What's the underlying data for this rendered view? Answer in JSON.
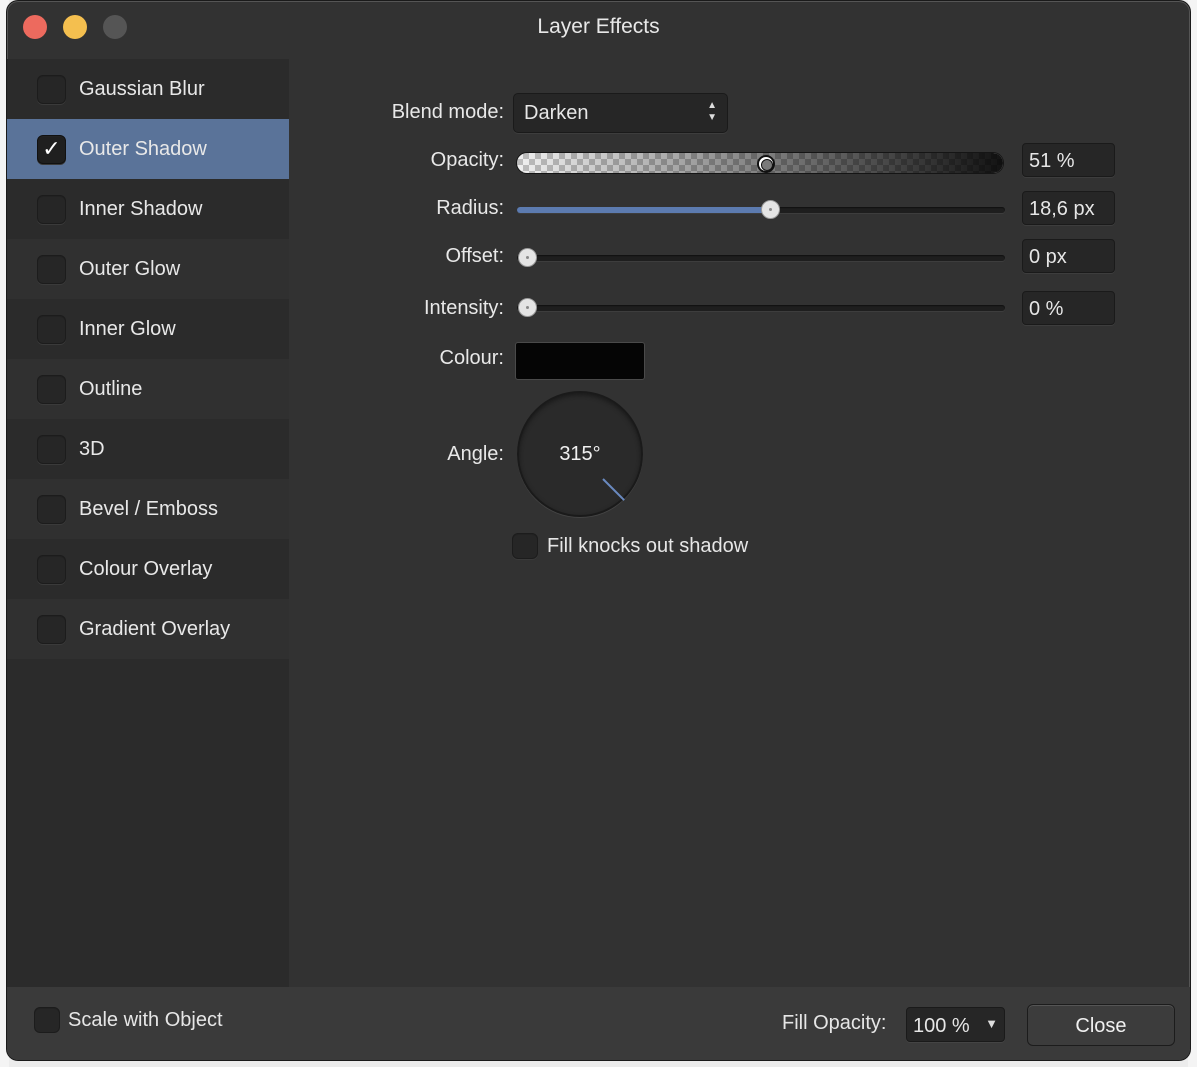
{
  "window": {
    "title": "Layer Effects"
  },
  "effects": [
    {
      "label": "Gaussian Blur",
      "checked": false
    },
    {
      "label": "Outer Shadow",
      "checked": true
    },
    {
      "label": "Inner Shadow",
      "checked": false
    },
    {
      "label": "Outer Glow",
      "checked": false
    },
    {
      "label": "Inner Glow",
      "checked": false
    },
    {
      "label": "Outline",
      "checked": false
    },
    {
      "label": "3D",
      "checked": false
    },
    {
      "label": "Bevel / Emboss",
      "checked": false
    },
    {
      "label": "Colour Overlay",
      "checked": false
    },
    {
      "label": "Gradient Overlay",
      "checked": false
    }
  ],
  "selected_effect": "Outer Shadow",
  "checkmark_glyph": "✓",
  "settings": {
    "blend_mode_label": "Blend mode:",
    "blend_mode_value": "Darken",
    "opacity_label": "Opacity:",
    "opacity_value": "51 %",
    "opacity_fraction": 0.51,
    "radius_label": "Radius:",
    "radius_value": "18,6 px",
    "radius_fraction": 0.52,
    "offset_label": "Offset:",
    "offset_value": "0 px",
    "offset_fraction": 0,
    "intensity_label": "Intensity:",
    "intensity_value": "0 %",
    "intensity_fraction": 0,
    "colour_label": "Colour:",
    "colour_value": "#050505",
    "angle_label": "Angle:",
    "angle_value": "315°",
    "fill_knocks_label": "Fill knocks out shadow",
    "fill_knocks_checked": false
  },
  "footer": {
    "scale_label": "Scale with Object",
    "fill_opacity_label": "Fill Opacity:",
    "fill_opacity_value": "100 %",
    "close_label": "Close"
  },
  "colors": {
    "accent": "#5a7399",
    "slider_fill": "#5c7bb0",
    "traffic_close": "#ed6a5e",
    "traffic_minimize": "#f4bf4f",
    "traffic_zoom": "#555555"
  }
}
